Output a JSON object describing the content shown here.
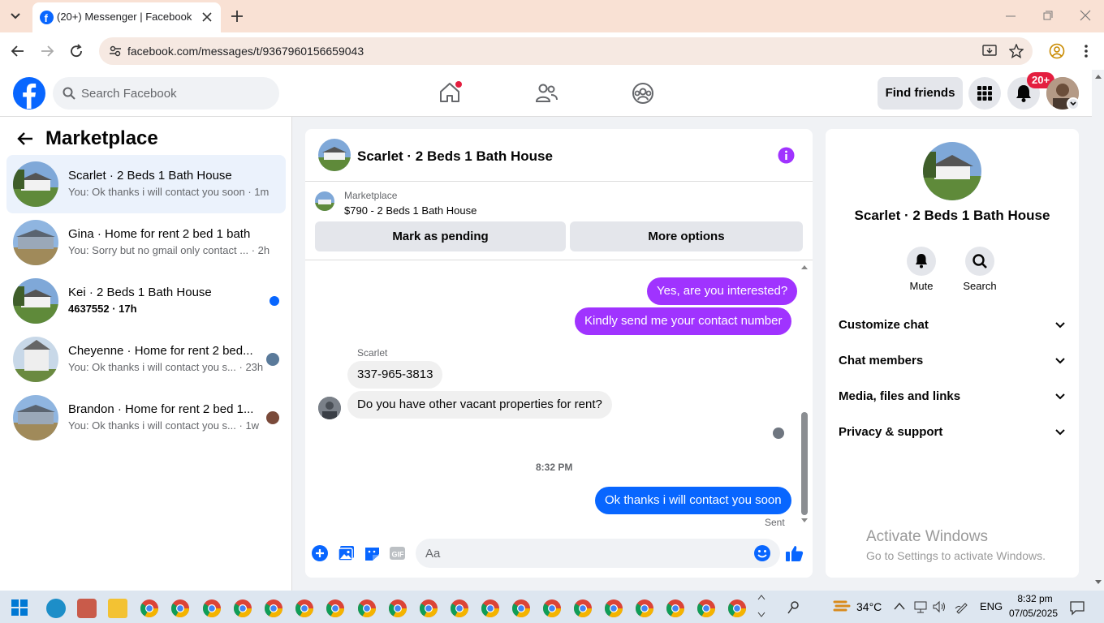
{
  "browser": {
    "tab_title": "(20+) Messenger | Facebook",
    "url": "facebook.com/messages/t/9367960156659043"
  },
  "fb_header": {
    "search_placeholder": "Search Facebook",
    "find_friends": "Find friends",
    "notif_count": "20+"
  },
  "left": {
    "title": "Marketplace",
    "conversations": [
      {
        "name": "Scarlet · 2 Beds 1 Bath House",
        "preview": "You: Ok thanks i will contact you soon · 1m",
        "active": true
      },
      {
        "name": "Gina · Home for rent 2 bed 1 bath",
        "preview": "You: Sorry but no gmail only contact ... · 2h"
      },
      {
        "name": "Kei · 2 Beds 1 Bath House",
        "preview": "4637552 · 17h",
        "unread": true
      },
      {
        "name": "Cheyenne · Home for rent 2 bed...",
        "preview": "You: Ok thanks i will contact you s... · 23h"
      },
      {
        "name": "Brandon · Home for rent 2 bed 1...",
        "preview": "You: Ok thanks i will contact you s... · 1w"
      }
    ]
  },
  "chat": {
    "title": "Scarlet · 2 Beds 1 Bath House",
    "marketplace_label": "Marketplace",
    "listing": "$790 - 2 Beds 1 Bath House",
    "mark_pending": "Mark as pending",
    "more_options": "More options",
    "messages": {
      "m1": "Yes, are you interested?",
      "m2": "Kindly send me your contact number",
      "sender": "Scarlet",
      "m3": "337-965-3813",
      "m4": "Do you have other vacant properties for rent?",
      "time": "8:32 PM",
      "m5": "Ok thanks i will contact you soon",
      "sent": "Sent"
    },
    "composer_placeholder": "Aa"
  },
  "right": {
    "title": "Scarlet · 2 Beds 1 Bath House",
    "mute": "Mute",
    "search": "Search",
    "sections": [
      "Customize chat",
      "Chat members",
      "Media, files and links",
      "Privacy & support"
    ],
    "activate_title": "Activate Windows",
    "activate_sub": "Go to Settings to activate Windows."
  },
  "taskbar": {
    "weather": "34°C",
    "lang": "ENG",
    "time": "8:32 pm",
    "date": "07/05/2025"
  },
  "colors": {
    "fb_blue": "#0866ff",
    "purple_bubble": "#a033ff",
    "accent_purple": "#a033ff"
  }
}
